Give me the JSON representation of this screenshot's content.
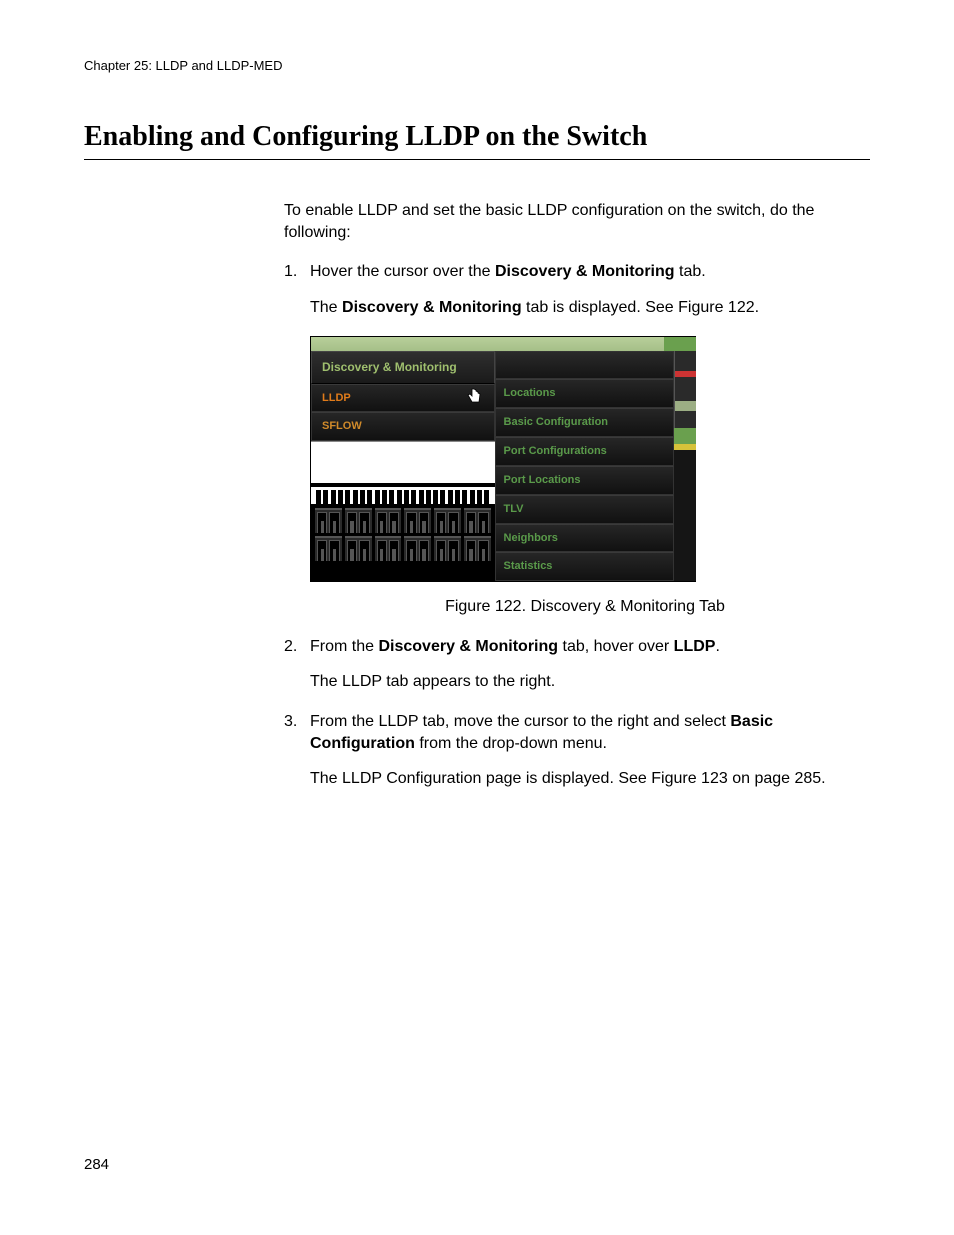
{
  "chapter_line": "Chapter 25: LLDP and LLDP-MED",
  "heading": "Enabling and Configuring LLDP on the Switch",
  "intro": "To enable LLDP and set the basic LLDP configuration on the switch, do the following:",
  "steps": {
    "s1": {
      "num": "1.",
      "pre": "Hover the cursor over the ",
      "bold": "Discovery & Monitoring",
      "post": " tab.",
      "sub_pre": "The ",
      "sub_bold": "Discovery & Monitoring",
      "sub_post": " tab is displayed. See Figure 122."
    },
    "s2": {
      "num": "2.",
      "pre": "From the ",
      "bold1": "Discovery & Monitoring",
      "mid": " tab, hover over ",
      "bold2": "LLDP",
      "post": ".",
      "sub": "The LLDP tab appears to the right."
    },
    "s3": {
      "num": "3.",
      "pre": "From the LLDP tab, move the cursor to the right and select ",
      "bold": "Basic Configuration",
      "post": " from the drop-down menu.",
      "sub": "The LLDP Configuration page is displayed. See Figure 123 on page 285."
    }
  },
  "figure": {
    "caption": "Figure 122. Discovery & Monitoring Tab",
    "menu_header": "Discovery & Monitoring",
    "left_items": [
      "LLDP",
      "SFLOW"
    ],
    "right_items": [
      "Locations",
      "Basic Configuration",
      "Port Configurations",
      "Port Locations",
      "TLV",
      "Neighbors",
      "Statistics"
    ]
  },
  "page_number": "284"
}
